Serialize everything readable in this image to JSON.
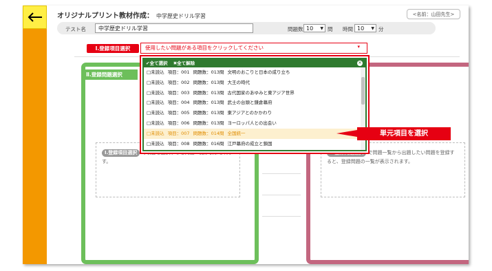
{
  "header": {
    "title_main": "オリジナルプリント教材作成：",
    "title_sub": "中学歴史ドリル学習",
    "name_badge": "<名前：山田先生>"
  },
  "settings": {
    "test_name_label": "テスト名",
    "test_name_value": "中学歴史ドリル学習",
    "question_count_label": "問題数",
    "question_count_value": "10",
    "question_count_unit": "問",
    "time_label": "時間",
    "time_value": "10",
    "time_unit": "分"
  },
  "step1": {
    "label": "Ⅰ.登録項目選択",
    "placeholder": "使用したい問題がある項目をクリックしてください"
  },
  "dropdown": {
    "select_all": "✔全て選択",
    "deselect_all": "✖全て解除",
    "items": [
      {
        "status": "□未読込",
        "item": "項目：001",
        "count": "問題数：013問",
        "title": "文明のおこりと日本の成り立ち"
      },
      {
        "status": "□未読込",
        "item": "項目：002",
        "count": "問題数：013問",
        "title": "大王の時代"
      },
      {
        "status": "□未読込",
        "item": "項目：003",
        "count": "問題数：013問",
        "title": "古代国家のあゆみと東アジア世界"
      },
      {
        "status": "□未読込",
        "item": "項目：004",
        "count": "問題数：013問",
        "title": "武士の台頭と鎌倉幕府"
      },
      {
        "status": "□未読込",
        "item": "項目：005",
        "count": "問題数：013問",
        "title": "東アジアとのかかわり"
      },
      {
        "status": "□未読込",
        "item": "項目：006",
        "count": "問題数：013問",
        "title": "ヨーロッパ人との出会い"
      },
      {
        "status": "□未読込",
        "item": "項目：007",
        "count": "問題数：014問",
        "title": "全国統一"
      },
      {
        "status": "□未読込",
        "item": "項目：008",
        "count": "問題数：016問",
        "title": "江戸幕府の成立と鎖国"
      }
    ]
  },
  "callout": "単元項目を選択",
  "left_panel": {
    "tab_label": "Ⅱ.登録問題選択",
    "hint_chip": "Ⅰ.登録項目選択",
    "hint_text": "で項目を選択すると問題一覧が表示されます。"
  },
  "right_panel": {
    "hint_chip": "Ⅱ.登録問題選択",
    "hint_text": "で問題一覧から出題したい問題を登録すると、登録問題の一覧が表示されます。"
  },
  "colors": {
    "accent_orange": "#f39800",
    "accent_red": "#e60012",
    "green": "#6dbf5b",
    "pink": "#c3667f",
    "dropdown_green": "#2f7a2f"
  }
}
